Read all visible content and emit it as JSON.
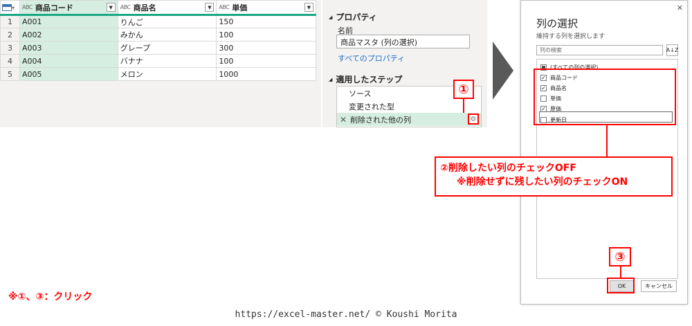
{
  "grid": {
    "columns": [
      {
        "type": "ABC",
        "name": "商品コード"
      },
      {
        "type": "ABC",
        "name": "商品名"
      },
      {
        "type": "ABC",
        "name": "単価"
      }
    ],
    "rows": [
      {
        "n": "1",
        "cells": [
          "A001",
          "りんご",
          "150"
        ]
      },
      {
        "n": "2",
        "cells": [
          "A002",
          "みかん",
          "100"
        ]
      },
      {
        "n": "3",
        "cells": [
          "A003",
          "グレープ",
          "300"
        ]
      },
      {
        "n": "4",
        "cells": [
          "A004",
          "バナナ",
          "100"
        ]
      },
      {
        "n": "5",
        "cells": [
          "A005",
          "メロン",
          "1000"
        ]
      }
    ]
  },
  "settings": {
    "properties_title": "プロパティ",
    "name_label": "名前",
    "name_value": "商品マスタ (列の選択)",
    "all_properties_link": "すべてのプロパティ",
    "steps_title": "適用したステップ",
    "steps": [
      "ソース",
      "変更された型",
      "削除された他の列"
    ],
    "active_step_prefix": "✕"
  },
  "dialog": {
    "close": "✕",
    "title": "列の選択",
    "subtitle": "維持する列を選択します",
    "search_placeholder": "列の検索",
    "sort_icon_label": "A↓Z",
    "select_all": "(すべての列の選択)",
    "columns": [
      {
        "name": "商品コード",
        "checked": true
      },
      {
        "name": "商品名",
        "checked": true
      },
      {
        "name": "単価",
        "checked": false
      },
      {
        "name": "原価",
        "checked": true
      },
      {
        "name": "更新日",
        "checked": false
      }
    ],
    "ok": "OK",
    "cancel": "キャンセル"
  },
  "annotations": {
    "step1": "①",
    "step3": "③",
    "note_line1": "②削除したい列のチェックOFF",
    "note_line2": "※削除せずに残したい列のチェックON",
    "footnote": "※①、③：クリック",
    "credit": "https://excel-master.net/ © Koushi Morita"
  },
  "colors": {
    "accent_green": "#1ba784",
    "annotation_red": "#ff0000",
    "link_blue": "#1e6fc6"
  }
}
